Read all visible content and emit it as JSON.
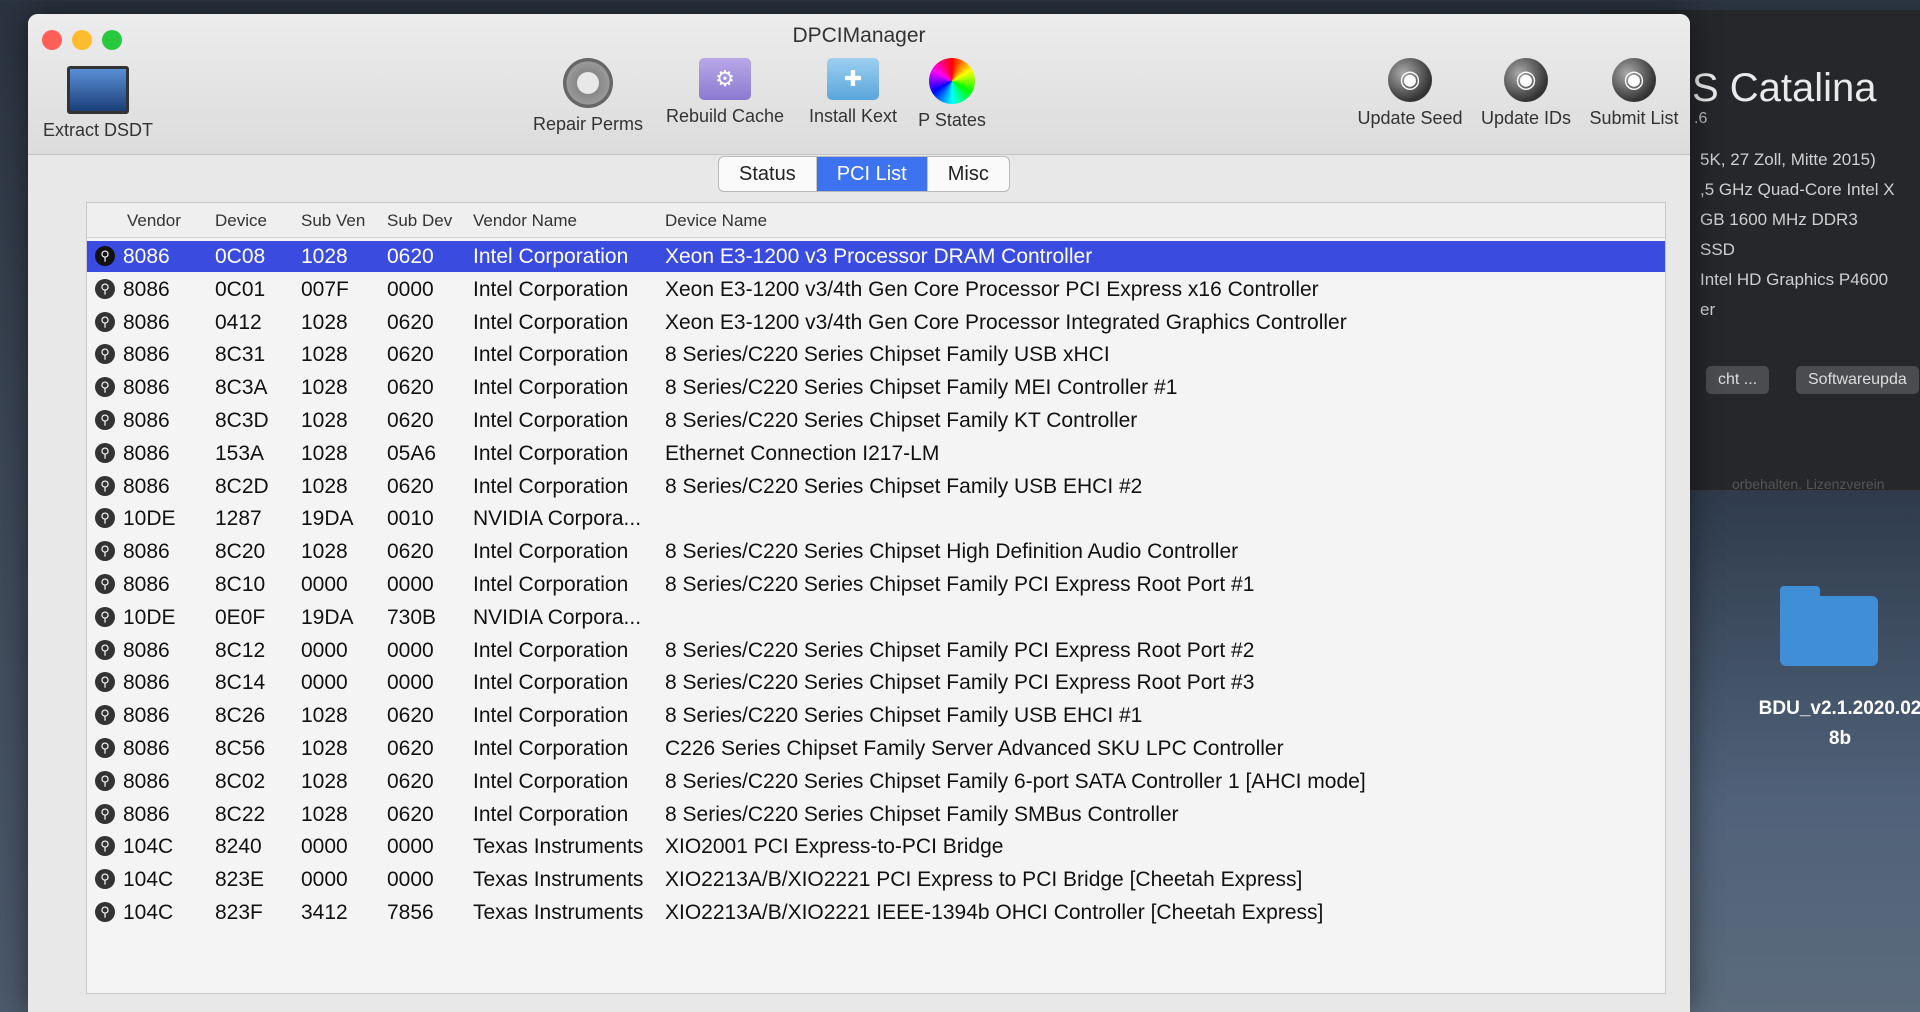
{
  "window": {
    "title": "DPCIManager"
  },
  "toolbar": {
    "extract_dsdt": "Extract DSDT",
    "repair_perms": "Repair Perms",
    "rebuild_cache": "Rebuild Cache",
    "install_kext": "Install Kext",
    "p_states": "P States",
    "update_seed": "Update Seed",
    "update_ids": "Update IDs",
    "submit_list": "Submit List"
  },
  "tabs": [
    {
      "label": "Status",
      "active": false
    },
    {
      "label": "PCI List",
      "active": true
    },
    {
      "label": "Misc",
      "active": false
    }
  ],
  "table": {
    "columns": [
      "Vendor",
      "Device",
      "Sub Ven",
      "Sub Dev",
      "Vendor Name",
      "Device Name"
    ],
    "rows": [
      [
        "8086",
        "0C08",
        "1028",
        "0620",
        "Intel Corporation",
        "Xeon E3-1200 v3 Processor DRAM Controller"
      ],
      [
        "8086",
        "0C01",
        "007F",
        "0000",
        "Intel Corporation",
        "Xeon E3-1200 v3/4th Gen Core Processor PCI Express x16 Controller"
      ],
      [
        "8086",
        "0412",
        "1028",
        "0620",
        "Intel Corporation",
        "Xeon E3-1200 v3/4th Gen Core Processor Integrated Graphics Controller"
      ],
      [
        "8086",
        "8C31",
        "1028",
        "0620",
        "Intel Corporation",
        "8 Series/C220 Series Chipset Family USB xHCI"
      ],
      [
        "8086",
        "8C3A",
        "1028",
        "0620",
        "Intel Corporation",
        "8 Series/C220 Series Chipset Family MEI Controller #1"
      ],
      [
        "8086",
        "8C3D",
        "1028",
        "0620",
        "Intel Corporation",
        "8 Series/C220 Series Chipset Family KT Controller"
      ],
      [
        "8086",
        "153A",
        "1028",
        "05A6",
        "Intel Corporation",
        "Ethernet Connection I217-LM"
      ],
      [
        "8086",
        "8C2D",
        "1028",
        "0620",
        "Intel Corporation",
        "8 Series/C220 Series Chipset Family USB EHCI #2"
      ],
      [
        "10DE",
        "1287",
        "19DA",
        "0010",
        "NVIDIA Corpora...",
        ""
      ],
      [
        "8086",
        "8C20",
        "1028",
        "0620",
        "Intel Corporation",
        "8 Series/C220 Series Chipset High Definition Audio Controller"
      ],
      [
        "8086",
        "8C10",
        "0000",
        "0000",
        "Intel Corporation",
        "8 Series/C220 Series Chipset Family PCI Express Root Port #1"
      ],
      [
        "10DE",
        "0E0F",
        "19DA",
        "730B",
        "NVIDIA Corpora...",
        ""
      ],
      [
        "8086",
        "8C12",
        "0000",
        "0000",
        "Intel Corporation",
        "8 Series/C220 Series Chipset Family PCI Express Root Port #2"
      ],
      [
        "8086",
        "8C14",
        "0000",
        "0000",
        "Intel Corporation",
        "8 Series/C220 Series Chipset Family PCI Express Root Port #3"
      ],
      [
        "8086",
        "8C26",
        "1028",
        "0620",
        "Intel Corporation",
        "8 Series/C220 Series Chipset Family USB EHCI #1"
      ],
      [
        "8086",
        "8C56",
        "1028",
        "0620",
        "Intel Corporation",
        "C226 Series Chipset Family Server Advanced SKU LPC Controller"
      ],
      [
        "8086",
        "8C02",
        "1028",
        "0620",
        "Intel Corporation",
        "8 Series/C220 Series Chipset Family 6-port SATA Controller 1 [AHCI mode]"
      ],
      [
        "8086",
        "8C22",
        "1028",
        "0620",
        "Intel Corporation",
        "8 Series/C220 Series Chipset Family SMBus Controller"
      ],
      [
        "104C",
        "8240",
        "0000",
        "0000",
        "Texas Instruments",
        "XIO2001 PCI Express-to-PCI Bridge"
      ],
      [
        "104C",
        "823E",
        "0000",
        "0000",
        "Texas Instruments",
        "XIO2213A/B/XIO2221 PCI Express to PCI Bridge [Cheetah Express]"
      ],
      [
        "104C",
        "823F",
        "3412",
        "7856",
        "Texas Instruments",
        "XIO2213A/B/XIO2221 IEEE-1394b OHCI Controller [Cheetah Express]"
      ]
    ],
    "selected_row": 0
  },
  "background_window": {
    "os_title": "S Catalina",
    "os_version": ".6",
    "specs": [
      "5K, 27 Zoll, Mitte 2015)",
      ",5 GHz Quad-Core Intel X",
      "GB 1600 MHz DDR3",
      "SSD",
      "Intel HD Graphics P4600",
      "er"
    ],
    "buttons": [
      "cht ...",
      "Softwareupda"
    ],
    "footer": "orbehalten. Lizenzverein"
  },
  "desktop": {
    "folder_label_line1": "BDU_v2.1.2020.02",
    "folder_label_line2": "8b"
  },
  "colors": {
    "selection": "#3a4be0",
    "tab_active": "#3d73f0",
    "close": "#ff5f57",
    "minimize": "#febc2e",
    "zoom": "#28c840"
  }
}
